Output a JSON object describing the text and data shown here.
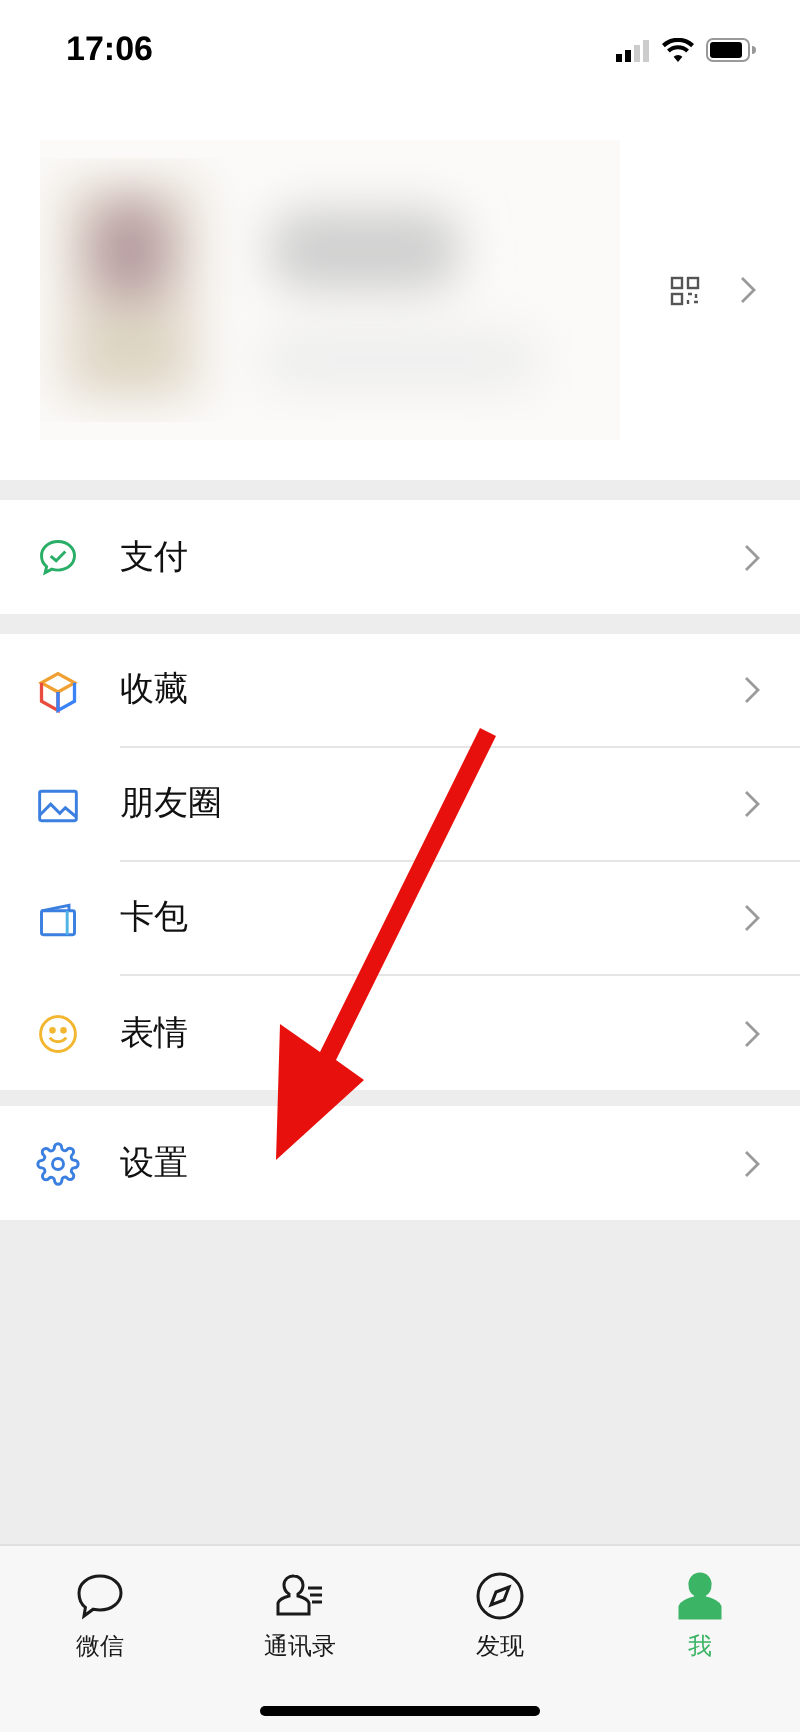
{
  "status_bar": {
    "time": "17:06"
  },
  "menu_groups": [
    {
      "items": [
        {
          "label": "支付",
          "kind": "pay"
        }
      ]
    },
    {
      "items": [
        {
          "label": "收藏",
          "kind": "favorites"
        },
        {
          "label": "朋友圈",
          "kind": "moments"
        },
        {
          "label": "卡包",
          "kind": "cards"
        },
        {
          "label": "表情",
          "kind": "stickers"
        }
      ]
    },
    {
      "items": [
        {
          "label": "设置",
          "kind": "settings"
        }
      ]
    }
  ],
  "tab_bar": [
    {
      "label": "微信",
      "kind": "chats",
      "selected": false
    },
    {
      "label": "通讯录",
      "kind": "contacts",
      "selected": false
    },
    {
      "label": "发现",
      "kind": "discover",
      "selected": false
    },
    {
      "label": "我",
      "kind": "me",
      "selected": true
    }
  ]
}
